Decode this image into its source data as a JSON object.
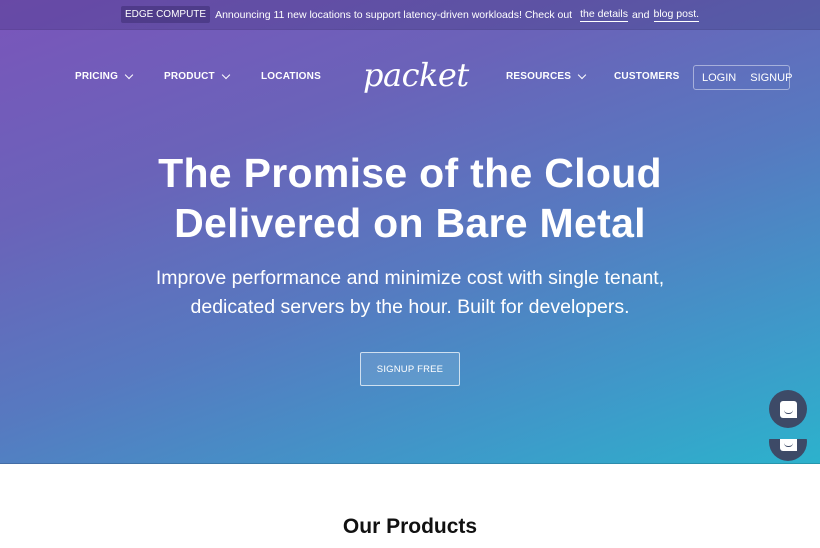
{
  "announcement": {
    "badge": "EDGE COMPUTE",
    "text": "Announcing 11 new locations to support latency-driven workloads! Check out",
    "link1": "the details",
    "and": "and",
    "link2": "blog post."
  },
  "nav": {
    "left": [
      {
        "label": "PRICING",
        "dropdown": true
      },
      {
        "label": "PRODUCT",
        "dropdown": true
      },
      {
        "label": "LOCATIONS",
        "dropdown": false
      }
    ],
    "logo": "packet",
    "right": [
      {
        "label": "RESOURCES",
        "dropdown": true
      },
      {
        "label": "CUSTOMERS",
        "dropdown": false
      }
    ],
    "login": "LOGIN",
    "signup": "SIGNUP"
  },
  "hero": {
    "title_line1": "The Promise of the Cloud",
    "title_line2": "Delivered on Bare Metal",
    "subtitle_line1": "Improve performance and minimize cost with single tenant,",
    "subtitle_line2": "dedicated servers by the hour. Built for developers.",
    "cta": "SIGNUP FREE"
  },
  "products": {
    "title": "Our Products"
  },
  "colors": {
    "gradient_start": "#7a55bb",
    "gradient_end": "#2cb2cc",
    "chat_widget": "#3d4a67"
  }
}
